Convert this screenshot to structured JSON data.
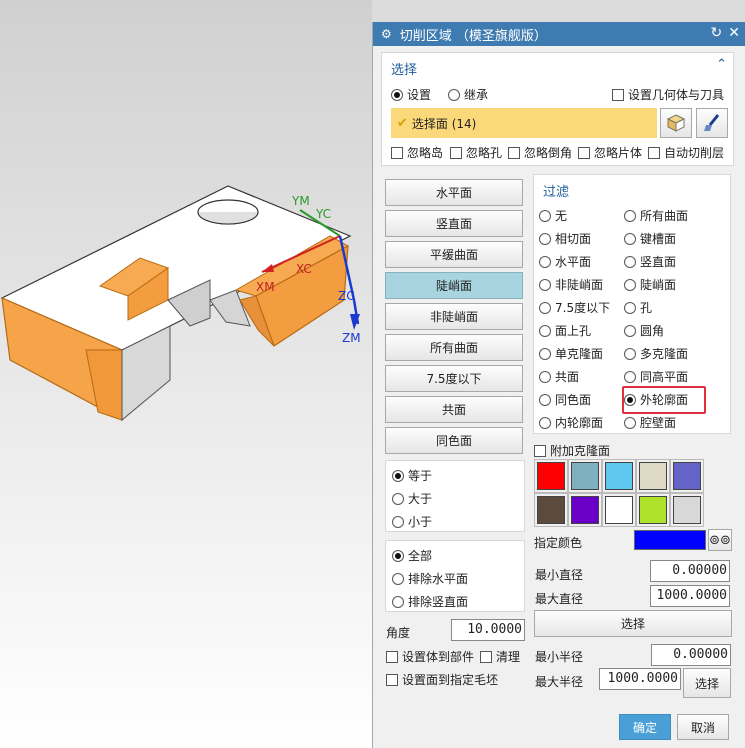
{
  "viewport": {
    "axes": {
      "ym": "YM",
      "yc": "YC",
      "xc": "XC",
      "xm": "XM",
      "zc": "ZC",
      "zm": "ZM"
    }
  },
  "dialog": {
    "title": "切削区域 （模圣旗舰版）",
    "select_section": {
      "header": "选择",
      "radio_settings": "设置",
      "radio_inherit": "继承",
      "set_geometry_tool": "设置几何体与刀具",
      "select_face": "选择面 (14)",
      "ignore_island": "忽略岛",
      "ignore_hole": "忽略孔",
      "ignore_chamfer": "忽略倒角",
      "ignore_sheet": "忽略片体",
      "auto_cut_layer": "自动切削层"
    },
    "face_buttons": [
      "水平面",
      "竖直面",
      "平缓曲面",
      "陡峭面",
      "非陡峭面",
      "所有曲面",
      "7.5度以下",
      "共面",
      "同色面"
    ],
    "active_face_button": "陡峭面",
    "compare": {
      "equal": "等于",
      "greater": "大于",
      "less": "小于"
    },
    "scope": {
      "all": "全部",
      "exclude_horizontal": "排除水平面",
      "exclude_vertical": "排除竖直面"
    },
    "angle_label": "角度",
    "angle_value": "10.0000",
    "set_body_to_part": "设置体到部件",
    "clear": "清理",
    "set_face_to_blank": "设置面到指定毛坯",
    "filter": {
      "header": "过滤",
      "options_left": [
        "无",
        "相切面",
        "水平面",
        "非陡峭面",
        "7.5度以下",
        "面上孔",
        "单克隆面",
        "共面",
        "同色面",
        "内轮廓面"
      ],
      "options_right": [
        "所有曲面",
        "键槽面",
        "竖直面",
        "陡峭面",
        "孔",
        "圆角",
        "多克隆面",
        "同高平面",
        "外轮廓面",
        "腔壁面"
      ],
      "selected": "外轮廓面"
    },
    "add_clone_face": "附加克隆面",
    "swatch_colors": [
      "#ff0000",
      "#7fb0c0",
      "#5ec8f0",
      "#ddd9c4",
      "#6464c8",
      "#5c4a3c",
      "#6a00c8",
      "#ffffff",
      "#aee22a",
      "#d8d8d8"
    ],
    "specify_color_label": "指定颜色",
    "specify_color_value": "#0000ff",
    "min_diameter_label": "最小直径",
    "min_diameter_value": "0.00000",
    "max_diameter_label": "最大直径",
    "max_diameter_value": "1000.0000",
    "select_button": "选择",
    "min_radius_label": "最小半径",
    "min_radius_value": "0.00000",
    "max_radius_label": "最大半径",
    "max_radius_value": "1000.0000",
    "select_button_2": "选择",
    "ok": "确定",
    "cancel": "取消"
  }
}
